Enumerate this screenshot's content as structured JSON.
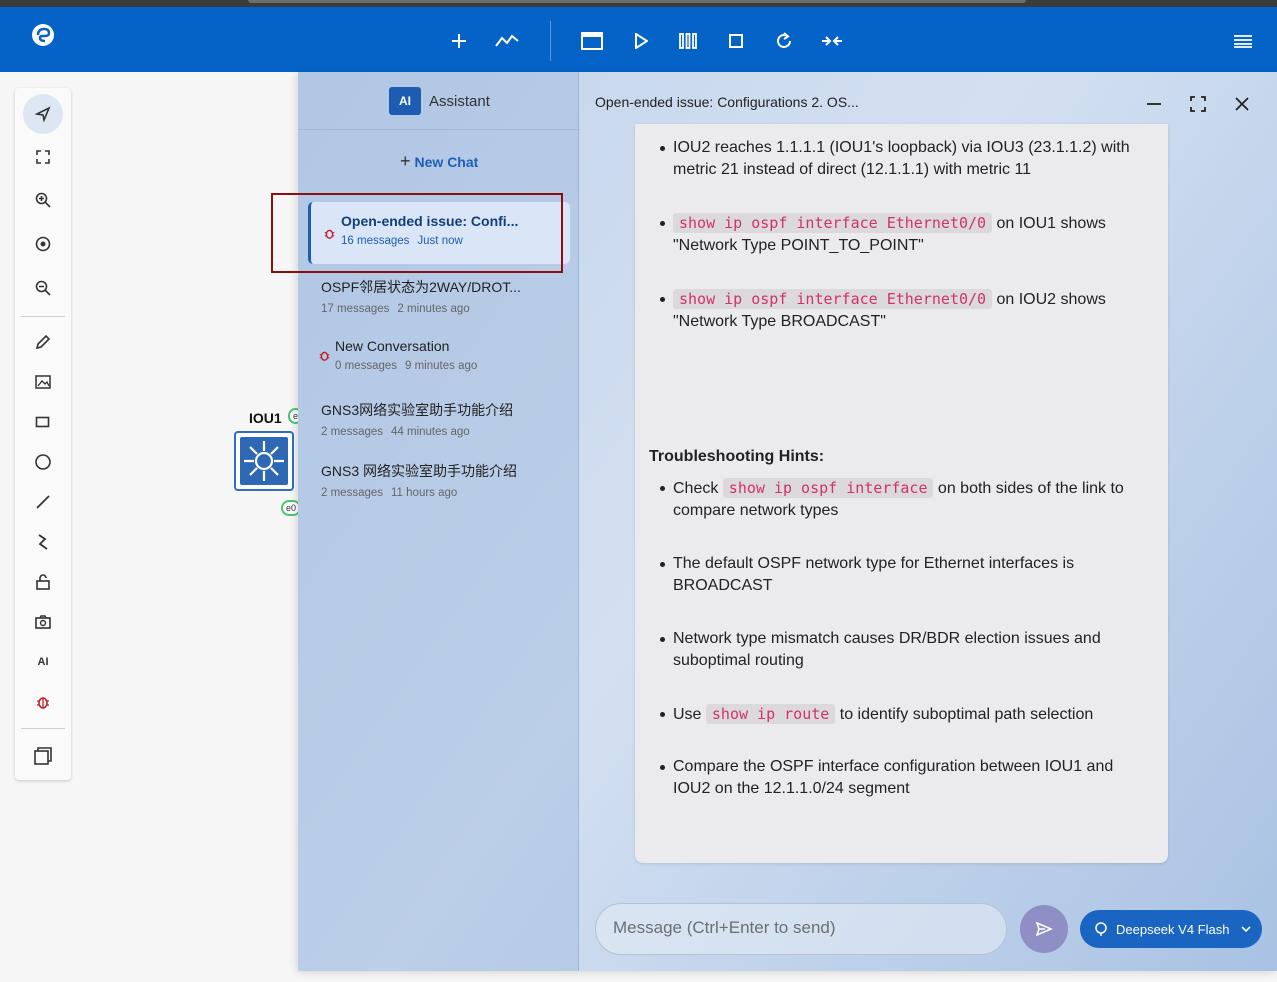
{
  "toolbar": {
    "buttons": [
      "add-icon",
      "chart-icon",
      "console-icon",
      "start-icon",
      "pause-icon",
      "stop-icon",
      "reload-icon",
      "collapse-icon"
    ],
    "menu_icon": "menu-icon"
  },
  "left_tools": [
    "pointer-icon",
    "fit-icon",
    "zoom-in-icon",
    "reset-zoom-icon",
    "zoom-out-icon",
    "pencil-icon",
    "image-icon",
    "rectangle-icon",
    "ellipse-icon",
    "line-icon",
    "curve-icon",
    "lock-icon",
    "camera-icon",
    "ai-icon",
    "bug-icon",
    "layers-icon"
  ],
  "left_ai_text": "AI",
  "canvas": {
    "node_label": "IOU1",
    "port_labels": [
      "e",
      "e0"
    ]
  },
  "assistant": {
    "badge": "AI",
    "title": "Assistant",
    "new_chat": "New Chat",
    "conversations": [
      {
        "title": "Open-ended issue: Confi...",
        "count": "16 messages",
        "time": "Just now",
        "bug": true,
        "active": true
      },
      {
        "title": "OSPF邻居状态为2WAY/DROT...",
        "count": "17 messages",
        "time": "2 minutes ago",
        "bug": false,
        "active": false
      },
      {
        "title": "New Conversation",
        "count": "0 messages",
        "time": "9 minutes ago",
        "bug": true,
        "active": false
      },
      {
        "title": "GNS3网络实验室助手功能介绍",
        "count": "2 messages",
        "time": "44 minutes ago",
        "bug": false,
        "active": false
      },
      {
        "title": "GNS3 网络实验室助手功能介绍",
        "count": "2 messages",
        "time": "11 hours ago",
        "bug": false,
        "active": false
      }
    ]
  },
  "chat": {
    "header_title": "Open-ended issue: Configurations 2. OS...",
    "bullets_top": [
      {
        "pre": "IOU2 reaches 1.1.1.1 (IOU1's loopback) via IOU3 (23.1.1.2) with metric 21 instead of direct (12.1.1.1) with metric 11"
      },
      {
        "code": "show ip ospf interface Ethernet0/0",
        "post": " on IOU1 shows \"Network Type POINT_TO_POINT\""
      },
      {
        "code": "show ip ospf interface Ethernet0/0",
        "post": " on IOU2 shows \"Network Type BROADCAST\""
      }
    ],
    "hints_title": "Troubleshooting Hints:",
    "bullets_hints": [
      {
        "pre": "Check ",
        "code": "show ip ospf interface",
        "post": " on both sides of the link to compare network types"
      },
      {
        "pre": "The default OSPF network type for Ethernet interfaces is BROADCAST"
      },
      {
        "pre": "Network type mismatch causes DR/BDR election issues and suboptimal routing"
      },
      {
        "pre": "Use ",
        "code": "show ip route",
        "post": " to identify suboptimal path selection"
      },
      {
        "pre": "Compare the OSPF interface configuration between IOU1 and IOU2 on the 12.1.1.0/24 segment"
      }
    ],
    "input_placeholder": "Message (Ctrl+Enter to send)",
    "model": "Deepseek V4 Flash"
  },
  "colors": {
    "toolbar": "#0562c6",
    "accent": "#1d5cb0",
    "code": "#d0326a",
    "highlight": "#8a1010"
  }
}
